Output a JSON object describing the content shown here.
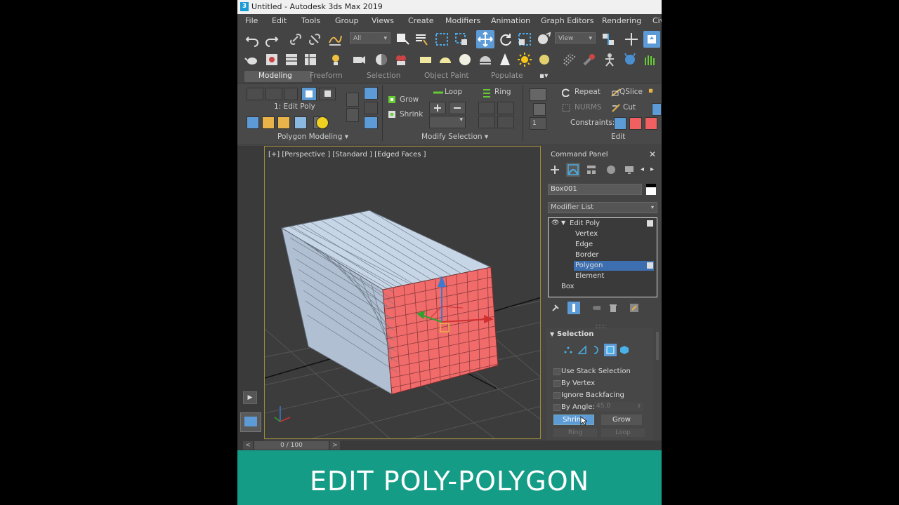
{
  "window": {
    "title": "Untitled - Autodesk 3ds Max 2019",
    "app_icon_letter": "3"
  },
  "menu": [
    "File",
    "Edit",
    "Tools",
    "Group",
    "Views",
    "Create",
    "Modifiers",
    "Animation",
    "Graph Editors",
    "Rendering",
    "Civ"
  ],
  "toolbar": {
    "selection_filter": "All",
    "ref_coord": "View"
  },
  "ribbon": {
    "tabs": [
      "Modeling",
      "Freeform",
      "Selection",
      "Object Paint",
      "Populate"
    ],
    "active_tab": "Modeling",
    "stack_label": "1: Edit Poly",
    "grow": "Grow",
    "shrink": "Shrink",
    "loop": "Loop",
    "ring": "Ring",
    "repeat": "Repeat",
    "qslice": "QSlice",
    "nurms": "NURMS",
    "cut": "Cut",
    "constraints": "Constraints:",
    "spinner_value": "1",
    "group_polygon_modeling": "Polygon Modeling",
    "group_modify_selection": "Modify Selection",
    "group_edit": "Edit"
  },
  "viewport": {
    "label": "[+] [Perspective ] [Standard ] [Edged Faces ]"
  },
  "command_panel": {
    "title": "Command Panel",
    "object_name": "Box001",
    "modifier_list": "Modifier List",
    "stack": {
      "modifier": "Edit Poly",
      "sub": [
        "Vertex",
        "Edge",
        "Border",
        "Polygon",
        "Element"
      ],
      "active_sub": "Polygon",
      "base": "Box"
    },
    "rollout_title": "Selection",
    "use_stack": "Use Stack Selection",
    "by_vertex": "By Vertex",
    "ignore_backfacing": "Ignore Backfacing",
    "by_angle": "By Angle:",
    "angle_value": "45.0",
    "shrink_btn": "Shrink",
    "grow_btn": "Grow",
    "ring_btn": "Ring",
    "loop_btn": "Loop"
  },
  "timeline": {
    "frame": "0 / 100",
    "prev": "<",
    "next": ">"
  },
  "banner": {
    "text": "EDIT POLY-POLYGON"
  },
  "colors": {
    "selected_face": "#f26b6b",
    "mesh_face": "#c9d9ea",
    "accent_blue": "#5d9bd6",
    "banner": "#159c86"
  }
}
